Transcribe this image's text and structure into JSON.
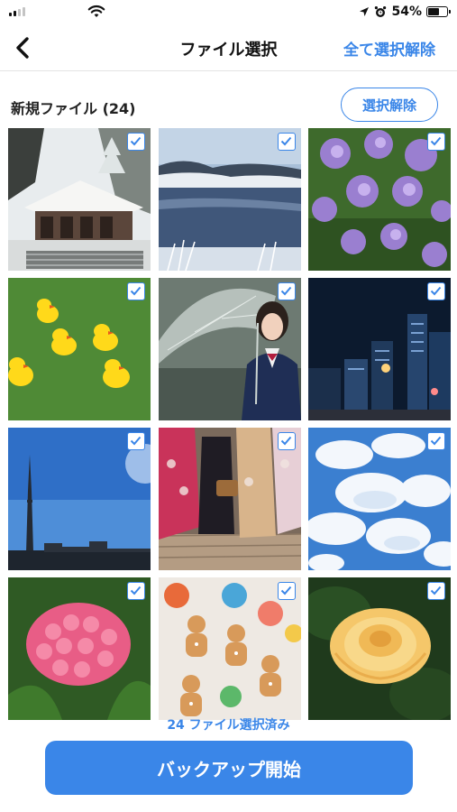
{
  "status_bar": {
    "battery_percent": "54%",
    "signal_bars": 2,
    "icons": [
      "signal-icon",
      "wifi-icon",
      "location-arrow-icon",
      "alarm-icon",
      "battery-icon"
    ]
  },
  "nav": {
    "back_icon": "chevron-left-icon",
    "title": "ファイル選択",
    "action_label": "全て選択解除"
  },
  "section": {
    "title": "新規ファイル (24)",
    "deselect_label": "選択解除"
  },
  "photos": [
    {
      "subject": "snow-temple",
      "selected": true
    },
    {
      "subject": "frozen-lake",
      "selected": true
    },
    {
      "subject": "purple-flowers",
      "selected": true
    },
    {
      "subject": "rubber-ducks",
      "selected": true
    },
    {
      "subject": "girl-umbrella",
      "selected": true
    },
    {
      "subject": "night-city",
      "selected": true
    },
    {
      "subject": "sky-tower",
      "selected": true
    },
    {
      "subject": "kimono-street",
      "selected": true
    },
    {
      "subject": "clouds-sky",
      "selected": true
    },
    {
      "subject": "pink-hydrangea",
      "selected": true
    },
    {
      "subject": "gingerbread-cookies",
      "selected": true
    },
    {
      "subject": "yellow-rose",
      "selected": true
    }
  ],
  "footer": {
    "selected_count_text": "24 ファイル選択済み",
    "backup_label": "バックアップ開始"
  },
  "colors": {
    "accent": "#3a86e8",
    "divider": "#e3e3e3",
    "text": "#111111"
  }
}
